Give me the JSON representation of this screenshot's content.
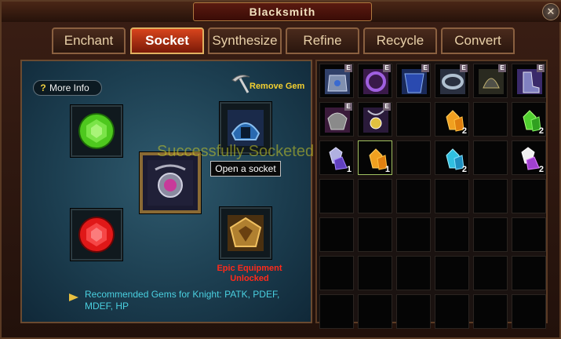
{
  "window": {
    "title": "Blacksmith",
    "close_icon": "close-icon"
  },
  "tabs": [
    {
      "label": "Enchant",
      "active": false
    },
    {
      "label": "Socket",
      "active": true
    },
    {
      "label": "Synthesize",
      "active": false
    },
    {
      "label": "Refine",
      "active": false
    },
    {
      "label": "Recycle",
      "active": false
    },
    {
      "label": "Convert",
      "active": false
    }
  ],
  "socket_panel": {
    "more_info": "More Info",
    "remove_gem": "Remove Gem",
    "status_message": "Successfully Socketed Gems",
    "open_socket_tooltip": "Open a socket",
    "epic_notice": "Epic Equipment Unlocked",
    "recommendation": "Recommended Gems for Knight: PATK, PDEF, MDEF, HP",
    "gem_colors": {
      "green": "#4ec81e",
      "red": "#e01818"
    }
  },
  "inventory": {
    "rows": [
      [
        {
          "item": "armor",
          "e": true
        },
        {
          "item": "ring",
          "e": true
        },
        {
          "item": "chest-armor",
          "e": true
        },
        {
          "item": "bracelet",
          "e": true
        },
        {
          "item": "helmet",
          "e": true
        },
        {
          "item": "boots",
          "e": true
        }
      ],
      [
        {
          "item": "pauldron",
          "e": true
        },
        {
          "item": "amulet",
          "e": true
        },
        null,
        {
          "item": "gold-gem",
          "count": "2"
        },
        null,
        {
          "item": "green-gem",
          "count": "2"
        }
      ],
      [
        {
          "item": "purple-gem",
          "count": "1"
        },
        {
          "item": "gold-gem",
          "count": "1",
          "selected": true
        },
        null,
        {
          "item": "cyan-gem",
          "count": "2"
        },
        null,
        {
          "item": "violet-gem",
          "count": "2"
        }
      ],
      [
        null,
        null,
        null,
        null,
        null,
        null
      ],
      [
        null,
        null,
        null,
        null,
        null,
        null
      ],
      [
        null,
        null,
        null,
        null,
        null,
        null
      ],
      [
        null,
        null,
        null,
        null,
        null,
        null
      ]
    ],
    "e_label": "E"
  }
}
